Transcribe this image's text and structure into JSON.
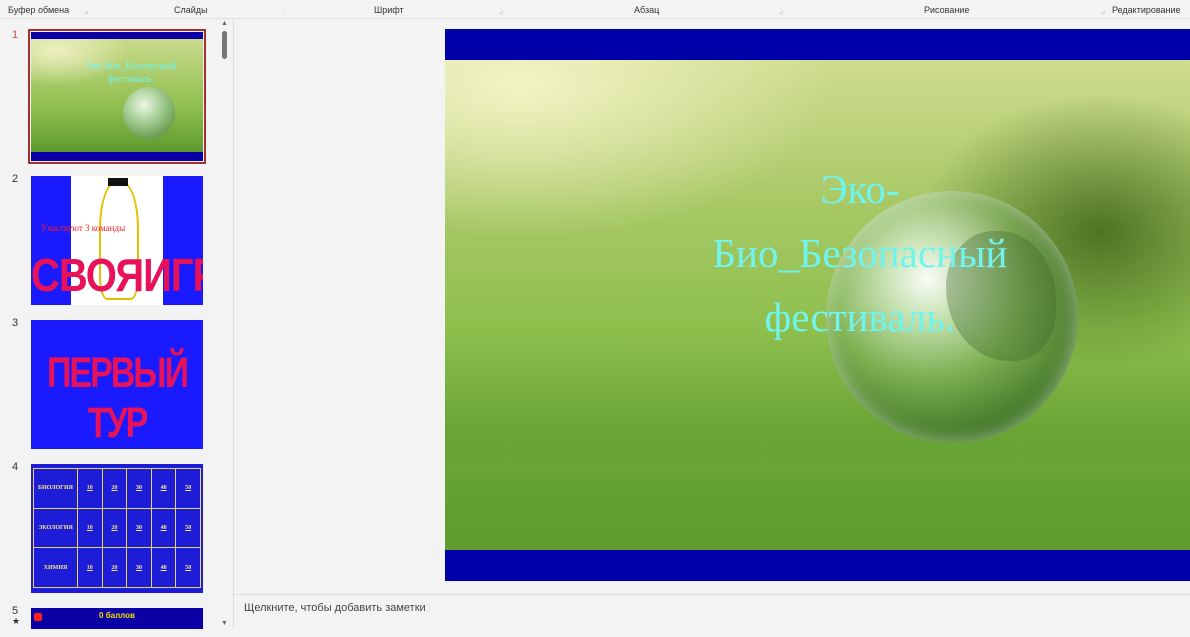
{
  "ribbon": {
    "groups": [
      "Буфер обмена",
      "Слайды",
      "Шрифт",
      "Абзац",
      "Рисование",
      "Редактирование"
    ]
  },
  "thumbnails": [
    {
      "number": "1",
      "title": "Эко-Био_Безопасный фестиваль."
    },
    {
      "number": "2",
      "caption": "Участвуют 3 команды",
      "art": "СВОЯИГРА"
    },
    {
      "number": "3",
      "art": "ПЕРВЫЙ ТУР"
    },
    {
      "number": "4",
      "rows": [
        {
          "label": "БИОЛОГИЯ",
          "values": [
            "10",
            "20",
            "30",
            "40",
            "50"
          ]
        },
        {
          "label": "ЭКОЛОГИЯ",
          "values": [
            "10",
            "20",
            "30",
            "40",
            "50"
          ]
        },
        {
          "label": "ХИМИЯ",
          "values": [
            "10",
            "20",
            "30",
            "40",
            "50"
          ]
        }
      ]
    },
    {
      "number": "5",
      "star": "★",
      "caption": "0 баллов"
    }
  ],
  "slide": {
    "title_lines": [
      "Эко-",
      "Био_Безопасный",
      "фестиваль."
    ]
  },
  "notes": {
    "placeholder": "Щелкните, чтобы добавить заметки"
  },
  "colors": {
    "title_cyan": "#6ff5ee",
    "slide_blue": "#0000a8",
    "art_pink": "#e8125a",
    "selection_red": "#a33030"
  }
}
